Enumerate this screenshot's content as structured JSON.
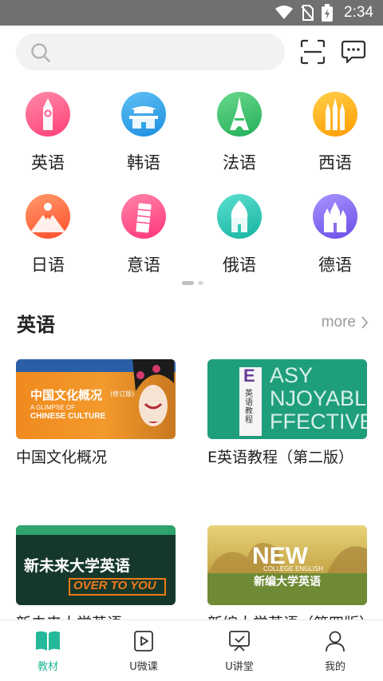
{
  "status_bar": {
    "time": "2:34"
  },
  "search": {
    "placeholder": ""
  },
  "categories": [
    {
      "label": "英语",
      "color": "#ff5c8a",
      "icon": "big-ben-icon"
    },
    {
      "label": "韩语",
      "color": "#2fa6ea",
      "icon": "palace-icon"
    },
    {
      "label": "法语",
      "color": "#36c46a",
      "icon": "eiffel-tower-icon"
    },
    {
      "label": "西语",
      "color": "#ffb21a",
      "icon": "sagrada-familia-icon"
    },
    {
      "label": "日语",
      "color": "#ff6a3d",
      "icon": "mount-fuji-icon"
    },
    {
      "label": "意语",
      "color": "#ff4f86",
      "icon": "leaning-tower-icon"
    },
    {
      "label": "俄语",
      "color": "#2cc9b5",
      "icon": "onion-dome-icon"
    },
    {
      "label": "德语",
      "color": "#8a6df0",
      "icon": "castle-icon"
    }
  ],
  "section": {
    "title": "英语",
    "more_label": "more"
  },
  "books": [
    {
      "title": "中国文化概况",
      "cover_title": "中国文化概况",
      "cover_edition": "(修订版)",
      "cover_en_1": "A GLIMPSE OF",
      "cover_en_2": "CHINESE CULTURE"
    },
    {
      "title": "E英语教程（第二版）",
      "cover_title": "英语教程",
      "cover_letter": "E",
      "cover_lines": [
        "ASY",
        "NJOYABLE",
        "FFECTIVE"
      ]
    },
    {
      "title": "新未来大学英语",
      "cover_title": "新未来大学英语",
      "cover_sub": "OVER TO YOU"
    },
    {
      "title": "新编大学英语（第四版）",
      "cover_big": "NEW",
      "cover_en": "COLLEGE ENGLISH",
      "cover_title": "新编大学英语"
    }
  ],
  "tabs": [
    {
      "label": "教材",
      "icon": "book-icon",
      "active": true
    },
    {
      "label": "U微课",
      "icon": "play-icon",
      "active": false
    },
    {
      "label": "U讲堂",
      "icon": "lecture-icon",
      "active": false
    },
    {
      "label": "我的",
      "icon": "user-icon",
      "active": false
    }
  ],
  "colors": {
    "accent": "#24b99a",
    "status_bar": "#707070"
  }
}
